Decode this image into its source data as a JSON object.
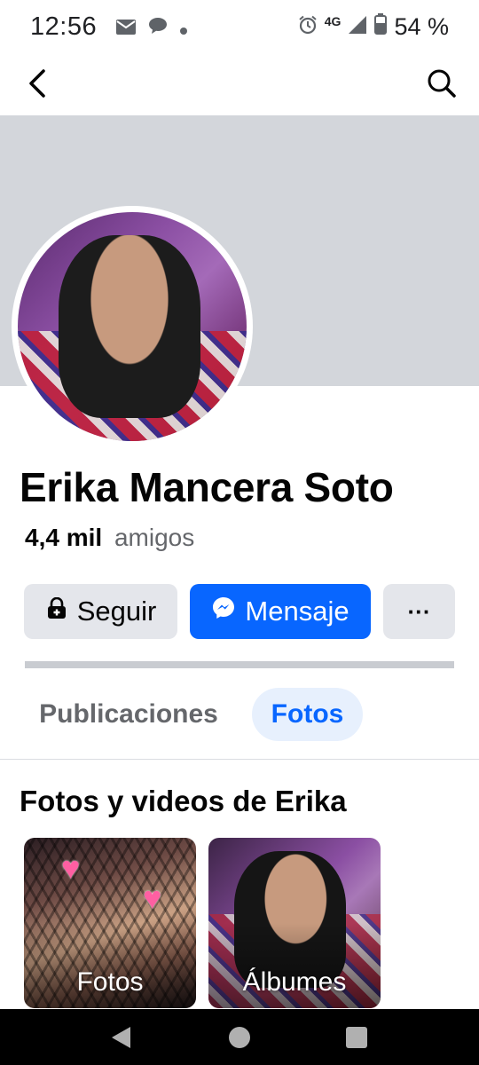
{
  "status_bar": {
    "time": "12:56",
    "network": "4G",
    "battery": "54 %",
    "icons": [
      "mail-icon",
      "chat-icon",
      "dot-icon",
      "alarm-icon",
      "signal-icon",
      "battery-icon"
    ]
  },
  "nav": {
    "back_icon": "back-arrow-icon",
    "search_icon": "search-icon"
  },
  "profile": {
    "name": "Erika Mancera Soto",
    "friends_count": "4,4 mil",
    "friends_label": "amigos"
  },
  "actions": {
    "follow_label": "Seguir",
    "message_label": "Mensaje",
    "more_label": "···",
    "follow_icon": "follow-lock-icon",
    "message_icon": "messenger-icon"
  },
  "colors": {
    "accent": "#0866ff",
    "button_gray": "#e4e6eb",
    "cover_gray": "#d3d6db",
    "active_tab_bg": "#e7f0fd",
    "secondary_text": "#65676b"
  },
  "tabs": [
    {
      "label": "Publicaciones",
      "active": false
    },
    {
      "label": "Fotos",
      "active": true
    }
  ],
  "media_section": {
    "title": "Fotos y videos de Erika",
    "tiles": [
      {
        "label": "Fotos"
      },
      {
        "label": "Álbumes"
      }
    ]
  },
  "system_nav": [
    "back-triangle-icon",
    "home-circle-icon",
    "recents-square-icon"
  ]
}
